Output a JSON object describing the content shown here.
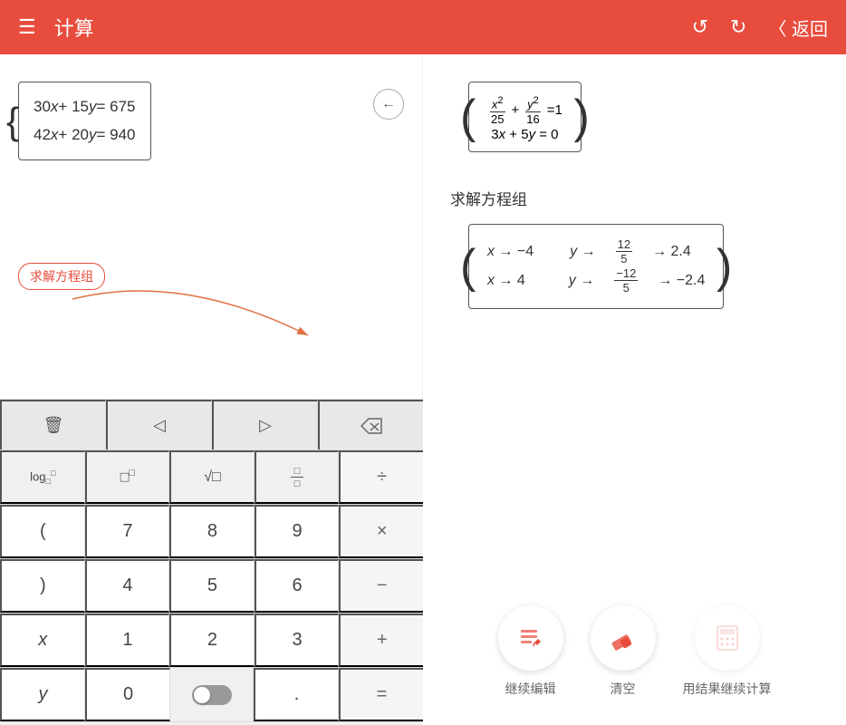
{
  "header": {
    "menu_icon": "☰",
    "title": "计算",
    "undo_label": "↺",
    "redo_label": "↻",
    "back_label": "〈 返回"
  },
  "left_panel": {
    "eq1": "30x + 15y = 675",
    "eq2": "42x + 20y = 940",
    "backspace_icon": "←",
    "tag": "求解方程组"
  },
  "right_panel": {
    "solve_label": "求解方程组",
    "result_row1_x": "x → −4",
    "result_row1_y_frac_num": "12",
    "result_row1_y_frac_den": "5",
    "result_row1_y_dec": "→ 2.4",
    "result_row2_x": "x → 4",
    "result_row2_y_frac_num": "−12",
    "result_row2_y_frac_den": "5",
    "result_row2_y_dec": "→ −2.4"
  },
  "keyboard": {
    "top_row": [
      "🗑",
      "◁",
      "▷",
      "⌫"
    ],
    "row1": [
      "log□□",
      "□°",
      "√□",
      "□/□",
      "÷"
    ],
    "row2": [
      "(",
      "7",
      "8",
      "9",
      "×"
    ],
    "row3": [
      ")",
      "4",
      "5",
      "6",
      "−"
    ],
    "row4": [
      "x",
      "1",
      "2",
      "3",
      "+"
    ],
    "row5": [
      "y",
      "0",
      ".",
      "="
    ]
  },
  "action_buttons": {
    "edit_label": "继续编辑",
    "clear_label": "清空",
    "use_result_label": "用结果继续计算"
  }
}
